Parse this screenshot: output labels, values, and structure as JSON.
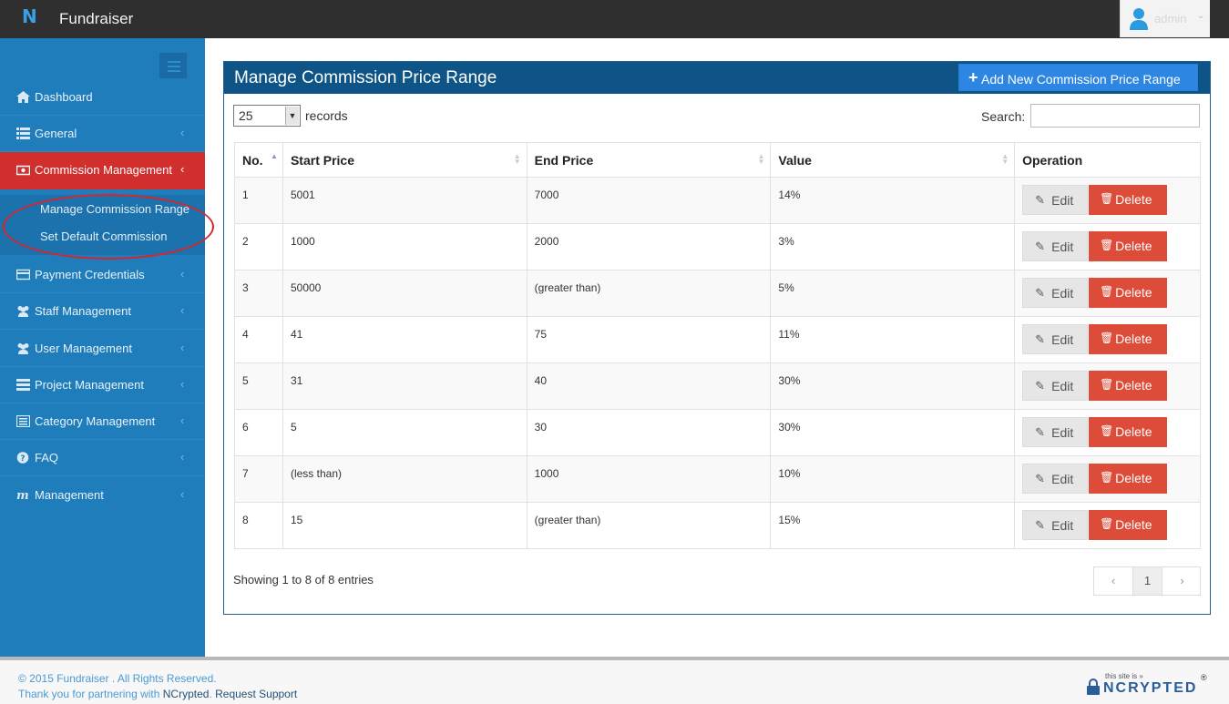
{
  "app": {
    "title": "Fundraiser",
    "logo_text": "N"
  },
  "user": {
    "name": "admin",
    "caret": "⌄"
  },
  "sidebar": {
    "items": [
      {
        "label": "Dashboard",
        "icon": "home-icon"
      },
      {
        "label": "General",
        "icon": "list-icon"
      },
      {
        "label": "Commission Management",
        "icon": "money-icon",
        "active": true
      },
      {
        "label": "Payment Credentials",
        "icon": "credit-card-icon"
      },
      {
        "label": "Staff Management",
        "icon": "users-icon"
      },
      {
        "label": "User Management",
        "icon": "users-icon"
      },
      {
        "label": "Project Management",
        "icon": "list-icon"
      },
      {
        "label": "Category Management",
        "icon": "list-alt-icon"
      },
      {
        "label": "FAQ",
        "icon": "question-circle-icon"
      },
      {
        "label": "Management",
        "icon": "m-icon"
      }
    ],
    "submenu": [
      {
        "label": "Manage Commission Range"
      },
      {
        "label": "Set Default Commission"
      }
    ],
    "chevron": "‹"
  },
  "panel": {
    "title": "Manage Commission Price Range",
    "add_button": "Add New Commission Price Range",
    "length_value": "25",
    "records_label": "records",
    "search_label": "Search:",
    "columns": [
      "No.",
      "Start Price",
      "End Price",
      "Value",
      "Operation"
    ],
    "rows": [
      {
        "no": "1",
        "start": "5001",
        "end": "7000",
        "value": "14%"
      },
      {
        "no": "2",
        "start": "1000",
        "end": "2000",
        "value": "3%"
      },
      {
        "no": "3",
        "start": "50000",
        "end": "(greater than)",
        "value": "5%"
      },
      {
        "no": "4",
        "start": "41",
        "end": "75",
        "value": "11%"
      },
      {
        "no": "5",
        "start": "31",
        "end": "40",
        "value": "30%"
      },
      {
        "no": "6",
        "start": "5",
        "end": "30",
        "value": "30%"
      },
      {
        "no": "7",
        "start": "(less than)",
        "end": "1000",
        "value": "10%"
      },
      {
        "no": "8",
        "start": "15",
        "end": "(greater than)",
        "value": "15%"
      }
    ],
    "edit_label": "Edit",
    "delete_label": "Delete",
    "info": "Showing 1 to 8 of 8 entries",
    "pager": {
      "prev": "‹",
      "page": "1",
      "next": "›"
    }
  },
  "footer": {
    "line1": "© 2015 Fundraiser . All Rights Reserved.",
    "line2_prefix": "Thank you for partnering with ",
    "line2_brand": "NCrypted",
    "line2_link": "Request Support",
    "badge_small": "this site is »",
    "badge_big": "NCRYPTED",
    "badge_reg": "®"
  },
  "colors": {
    "topbar": "#2f2f2f",
    "sidebar": "#1f7dbb",
    "active": "#d12f2d",
    "panel_header": "#0e5486",
    "add_button": "#2e86e3",
    "delete_button": "#dd4b39",
    "annotation_circle": "#d9252b"
  }
}
